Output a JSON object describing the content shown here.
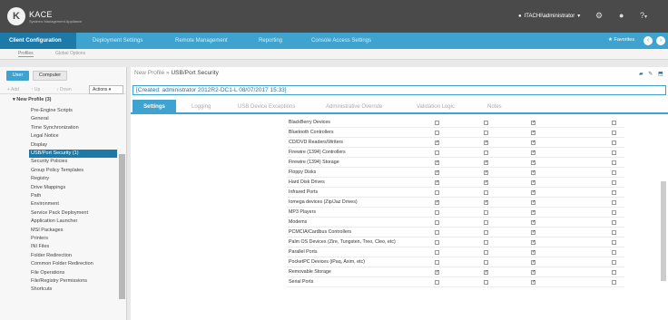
{
  "header": {
    "logo_letter": "K",
    "brand": "KACE",
    "brand_sub": "Systems Management Appliance",
    "user": "ITACHI\\administrator",
    "user_caret": "▾",
    "user_icon": "person-icon",
    "gear_icon": "⚙",
    "info_icon": "●",
    "help_icon": "?",
    "help_caret": "▾"
  },
  "nav": {
    "tabs": [
      "Client Configuration",
      "Deployment Settings",
      "Remote Management",
      "Reporting",
      "Console Access Settings"
    ],
    "favorites": "Favorites",
    "star": "★",
    "back": "‹",
    "forward": "›"
  },
  "subnav": {
    "items": [
      "Profiles",
      "Global Options"
    ]
  },
  "sidebar": {
    "user_btn": "User",
    "computer_btn": "Computer",
    "tools": [
      "+ Add",
      "↑ Up",
      "↓ Down"
    ],
    "actions": "Actions ▾",
    "root": "New Profile (3)",
    "items": [
      "Pre-Engine Scripts",
      "General",
      "Time Synchronization",
      "Legal Notice",
      "Display",
      "USB/Port Security (1)",
      "Security Policies",
      "Group Policy Templates",
      "Registry",
      "Drive Mappings",
      "Path",
      "Environment",
      "Service Pack Deployment",
      "Application Launcher",
      "MSI Packages",
      "Printers",
      "INI Files",
      "Folder Redirection",
      "Common Folder Redirection",
      "File Operations",
      "File/Registry Permissions",
      "Shortcuts"
    ]
  },
  "content": {
    "crumb_parent": "New Profile",
    "crumb_sep": " » ",
    "crumb_current": "USB/Port Security",
    "tool_icons": "▰ ✎ ⬒",
    "created": "[Created: administrator 2012R2-DC1-L 08/07/2017 15:33]",
    "tabs": [
      "Settings",
      "Logging",
      "USB Device Exceptions",
      "Administrative Override",
      "Validation Logic",
      "Notes"
    ],
    "check_mark": "✓",
    "rows": [
      {
        "name": "BlackBerry Devices",
        "c1": false,
        "c2": false,
        "c3": true,
        "c4": false
      },
      {
        "name": "Bluetooth Controllers",
        "c1": false,
        "c2": false,
        "c3": true,
        "c4": false
      },
      {
        "name": "CD/DVD Readers/Writers",
        "c1": true,
        "c2": true,
        "c3": true,
        "c4": false
      },
      {
        "name": "Firewire (1394) Controllers",
        "c1": false,
        "c2": false,
        "c3": true,
        "c4": false
      },
      {
        "name": "Firewire (1394) Storage",
        "c1": true,
        "c2": true,
        "c3": true,
        "c4": false
      },
      {
        "name": "Floppy Disks",
        "c1": true,
        "c2": true,
        "c3": true,
        "c4": false
      },
      {
        "name": "Hard Disk Drives",
        "c1": true,
        "c2": true,
        "c3": true,
        "c4": false
      },
      {
        "name": "Infrared Ports",
        "c1": false,
        "c2": false,
        "c3": true,
        "c4": false
      },
      {
        "name": "Iomega devices (Zip/Jaz Drives)",
        "c1": true,
        "c2": true,
        "c3": true,
        "c4": false
      },
      {
        "name": "MP3 Players",
        "c1": false,
        "c2": false,
        "c3": true,
        "c4": false
      },
      {
        "name": "Modems",
        "c1": false,
        "c2": false,
        "c3": true,
        "c4": false
      },
      {
        "name": "PCMCIA/Cardbus Controllers",
        "c1": false,
        "c2": false,
        "c3": true,
        "c4": false
      },
      {
        "name": "Palm OS Devices (Zire, Tungsten, Treo, Cleo, etc)",
        "c1": false,
        "c2": false,
        "c3": true,
        "c4": false
      },
      {
        "name": "Parallel Ports",
        "c1": false,
        "c2": false,
        "c3": true,
        "c4": false
      },
      {
        "name": "PocketPC Devices (iPaq, Axim, etc)",
        "c1": false,
        "c2": false,
        "c3": true,
        "c4": false
      },
      {
        "name": "Removable Storage",
        "c1": true,
        "c2": true,
        "c3": true,
        "c4": false
      },
      {
        "name": "Serial Ports",
        "c1": false,
        "c2": false,
        "c3": true,
        "c4": false
      }
    ]
  }
}
